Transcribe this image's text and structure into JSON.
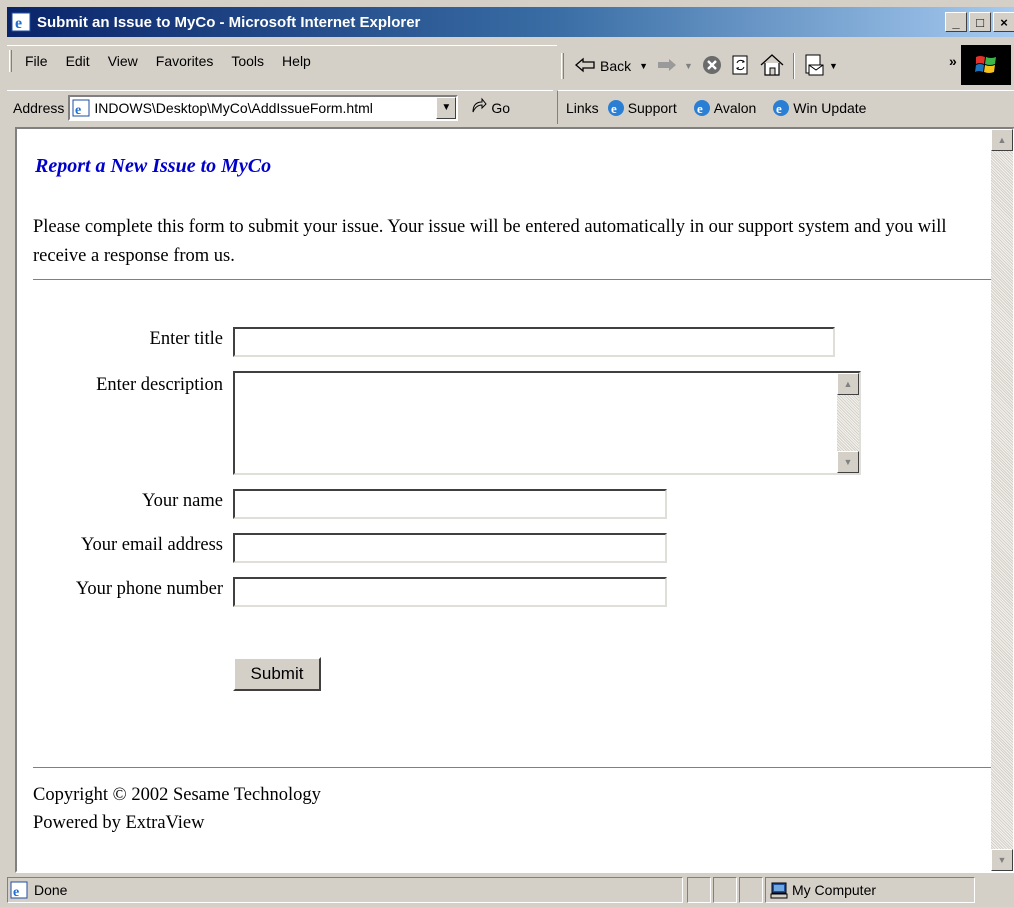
{
  "window": {
    "title": "Submit an Issue to MyCo - Microsoft Internet Explorer",
    "controls": {
      "minimize": "_",
      "maximize": "□",
      "close": "×"
    }
  },
  "menu": {
    "items": [
      {
        "label": "File"
      },
      {
        "label": "Edit"
      },
      {
        "label": "View"
      },
      {
        "label": "Favorites"
      },
      {
        "label": "Tools"
      },
      {
        "label": "Help"
      }
    ]
  },
  "toolbar": {
    "back_label": "Back",
    "chevron": "»"
  },
  "address": {
    "label": "Address",
    "value": "INDOWS\\Desktop\\MyCo\\AddIssueForm.html",
    "go_label": "Go"
  },
  "links": {
    "label": "Links",
    "items": [
      {
        "label": "Support"
      },
      {
        "label": "Avalon"
      },
      {
        "label": "Win Update"
      }
    ]
  },
  "page": {
    "heading": "Report a New Issue to MyCo",
    "intro": "Please complete this form to submit your issue. Your issue will be entered automatically in our support system and you will receive a response from us.",
    "form": {
      "title_label": "Enter title",
      "title_value": "",
      "description_label": "Enter description",
      "description_value": "",
      "name_label": "Your name",
      "name_value": "",
      "email_label": "Your email address",
      "email_value": "",
      "phone_label": "Your phone number",
      "phone_value": "",
      "submit_label": "Submit"
    },
    "footer": {
      "copyright": "Copyright © 2002 Sesame Technology",
      "powered_by": "Powered by ExtraView"
    }
  },
  "status": {
    "text": "Done",
    "zone": "My Computer"
  },
  "colors": {
    "heading": "#0000cc",
    "titlebar_start": "#0a246a",
    "titlebar_end": "#a6caf0",
    "chrome": "#d4d0c8"
  }
}
